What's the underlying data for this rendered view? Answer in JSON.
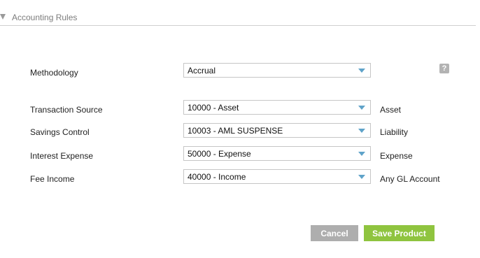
{
  "section": {
    "title": "Accounting Rules"
  },
  "help": {
    "glyph": "?"
  },
  "methodology": {
    "label": "Methodology",
    "value": "Accrual"
  },
  "rows": [
    {
      "label": "Transaction Source",
      "value": "10000 - Asset",
      "type": "Asset"
    },
    {
      "label": "Savings Control",
      "value": "10003 - AML SUSPENSE",
      "type": "Liability"
    },
    {
      "label": "Interest Expense",
      "value": "50000 - Expense",
      "type": "Expense"
    },
    {
      "label": "Fee Income",
      "value": "40000 - Income",
      "type": "Any GL Account"
    }
  ],
  "actions": {
    "cancel_label": "Cancel",
    "save_label": "Save Product"
  },
  "colors": {
    "accent": "#8fc43f",
    "dropdown_arrow": "#5fa3c9",
    "cancel": "#aeaeae"
  }
}
